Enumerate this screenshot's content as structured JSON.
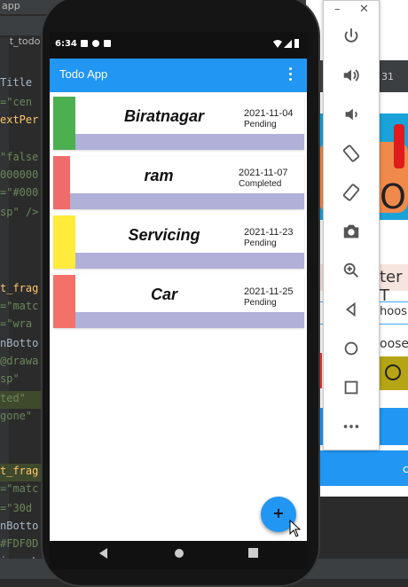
{
  "ide": {
    "title_fragment_a": "app",
    "title_fragment_b": "ist_todo.",
    "code_lines": [
      {
        "text": "Title",
        "color": "#a9b7c6"
      },
      {
        "text": "=\"cen",
        "color": "#6a8759"
      },
      {
        "text": "extPer",
        "color": "#ffc66d"
      },
      {
        "text": "\"false",
        "color": "#6a8759"
      },
      {
        "text": "000000",
        "color": "#6a8759"
      },
      {
        "text": "=\"#000",
        "color": "#6a8759"
      },
      {
        "text": "sp\" />",
        "color": "#6a8759"
      },
      {
        "text": "t_frag",
        "color": "#ffc66d"
      },
      {
        "text": "=\"matc",
        "color": "#6a8759"
      },
      {
        "text": "=\"wra",
        "color": "#6a8759"
      },
      {
        "text": "nBotto",
        "color": "#a9b7c6"
      },
      {
        "text": "@drawa",
        "color": "#6a8759"
      },
      {
        "text": "sp\"",
        "color": "#6a8759"
      },
      {
        "text": "ted\"",
        "color": "#6a8759"
      },
      {
        "text": "gone\"",
        "color": "#6a8759"
      },
      {
        "text": "t_frag",
        "color": "#ffc66d"
      },
      {
        "text": "=\"matc",
        "color": "#6a8759"
      },
      {
        "text": "=\"30d",
        "color": "#6a8759"
      },
      {
        "text": "nBotto",
        "color": "#a9b7c6"
      },
      {
        "text": "#FDF0D",
        "color": "#6a8759"
      },
      {
        "text": "inearLayo",
        "color": "#a9b7c6"
      }
    ],
    "toolbar_badge": "31"
  },
  "background_app": {
    "fragment_ter": "ter T",
    "fragment_hoos": "hoos",
    "fragment_oose": "oose",
    "fragment_c": "c",
    "fragment_o": "O"
  },
  "phone": {
    "status_time": "6:34",
    "app_title": "Todo App",
    "todos": [
      {
        "title": "Biratnagar",
        "date": "2021-11-04",
        "status": "Pending",
        "color": "#4caf50"
      },
      {
        "title": "ram",
        "date": "2021-11-07",
        "status": "Completed",
        "color": "#f06b6b"
      },
      {
        "title": "Servicing",
        "date": "2021-11-23",
        "status": "Pending",
        "color": "#ffeb3b"
      },
      {
        "title": "Car",
        "date": "2021-11-25",
        "status": "Pending",
        "color": "#f4716a"
      }
    ],
    "fab_label": "+",
    "accent": "#2196f3"
  },
  "emulator_controls": [
    "power-icon",
    "volume-up-icon",
    "volume-down-icon",
    "rotate-left-icon",
    "rotate-right-icon",
    "camera-icon",
    "zoom-icon",
    "back-icon",
    "home-icon",
    "overview-icon",
    "more-icon"
  ],
  "window_buttons": {
    "minimize": "–",
    "close": "✕"
  }
}
